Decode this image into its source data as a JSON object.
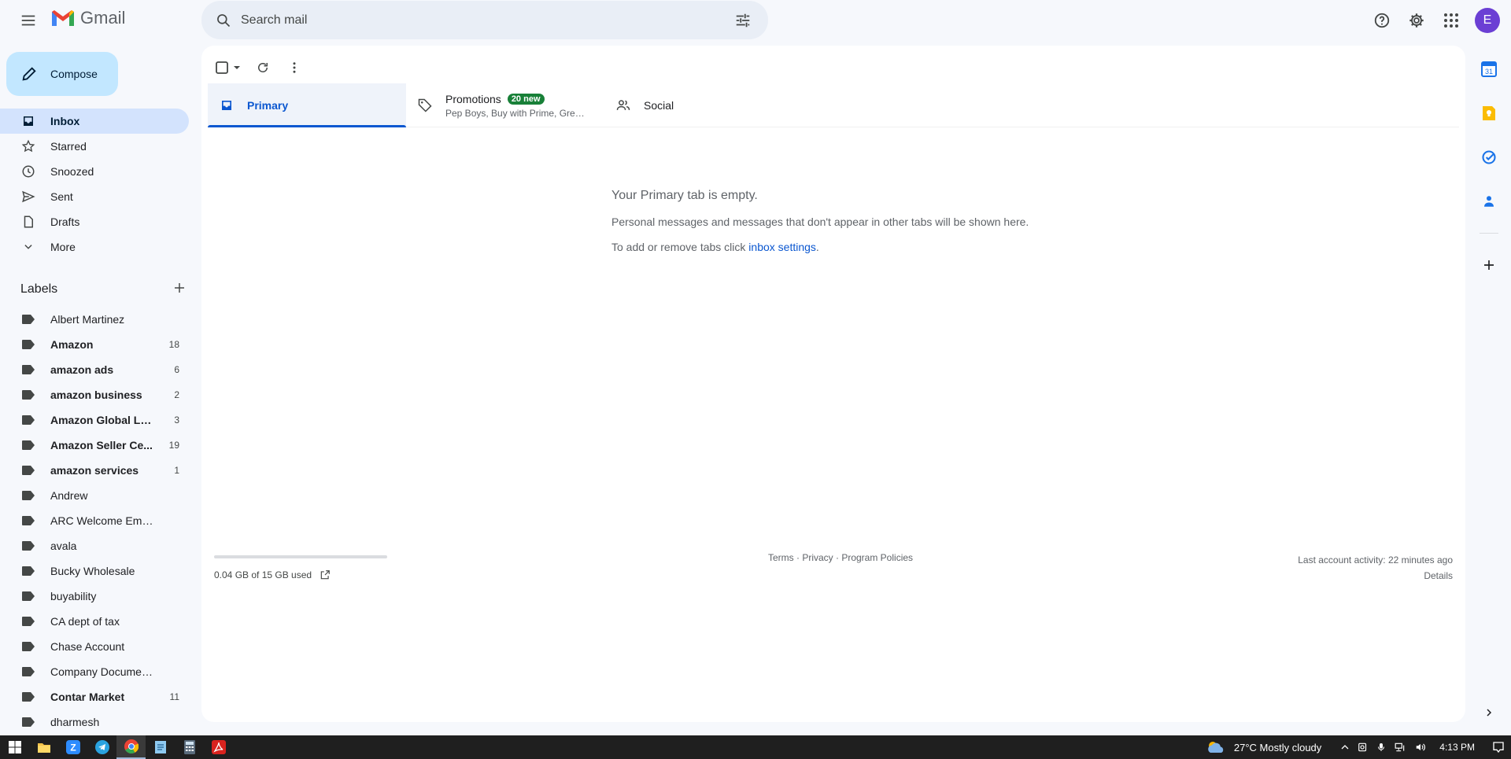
{
  "app": {
    "name": "Gmail"
  },
  "search": {
    "placeholder": "Search mail"
  },
  "account": {
    "initial": "E"
  },
  "compose": {
    "label": "Compose"
  },
  "nav": [
    {
      "label": "Inbox",
      "icon": "inbox-icon",
      "active": true
    },
    {
      "label": "Starred",
      "icon": "star-icon"
    },
    {
      "label": "Snoozed",
      "icon": "clock-icon"
    },
    {
      "label": "Sent",
      "icon": "send-icon"
    },
    {
      "label": "Drafts",
      "icon": "draft-icon"
    },
    {
      "label": "More",
      "icon": "chevron-down-icon"
    }
  ],
  "labels_header": "Labels",
  "labels": [
    {
      "name": "Albert Martinez",
      "count": "",
      "bold": false
    },
    {
      "name": "Amazon",
      "count": "18",
      "bold": true
    },
    {
      "name": "amazon ads",
      "count": "6",
      "bold": true
    },
    {
      "name": "amazon business",
      "count": "2",
      "bold": true
    },
    {
      "name": "Amazon Global Lo...",
      "count": "3",
      "bold": true
    },
    {
      "name": "Amazon Seller Ce...",
      "count": "19",
      "bold": true
    },
    {
      "name": "amazon services",
      "count": "1",
      "bold": true
    },
    {
      "name": "Andrew",
      "count": "",
      "bold": false
    },
    {
      "name": "ARC Welcome Emails",
      "count": "",
      "bold": false
    },
    {
      "name": "avala",
      "count": "",
      "bold": false
    },
    {
      "name": "Bucky Wholesale",
      "count": "",
      "bold": false
    },
    {
      "name": "buyability",
      "count": "",
      "bold": false
    },
    {
      "name": "CA dept of tax",
      "count": "",
      "bold": false
    },
    {
      "name": "Chase Account",
      "count": "",
      "bold": false
    },
    {
      "name": "Company Documents",
      "count": "",
      "bold": false
    },
    {
      "name": "Contar Market",
      "count": "11",
      "bold": true
    },
    {
      "name": "dharmesh",
      "count": "",
      "bold": false
    }
  ],
  "tabs": {
    "primary": {
      "label": "Primary"
    },
    "promotions": {
      "label": "Promotions",
      "badge": "20 new",
      "sub": "Pep Boys, Buy with Prime, Gree..."
    },
    "social": {
      "label": "Social"
    }
  },
  "empty_state": {
    "heading": "Your Primary tab is empty.",
    "line1": "Personal messages and messages that don't appear in other tabs will be shown here.",
    "line2_prefix": "To add or remove tabs click ",
    "link": "inbox settings",
    "line2_suffix": "."
  },
  "footer": {
    "storage": "0.04 GB of 15 GB used",
    "storage_used_fraction": 0.003,
    "links": "Terms · Privacy · Program Policies",
    "activity": "Last account activity: 22 minutes ago",
    "details": "Details"
  },
  "taskbar": {
    "weather": "27°C  Mostly cloudy",
    "time": "4:13 PM"
  },
  "colors": {
    "accent": "#0b57d0",
    "compose_bg": "#c2e7ff",
    "active_nav": "#d3e3fd",
    "badge": "#188038",
    "avatar": "#6b3fd4"
  }
}
